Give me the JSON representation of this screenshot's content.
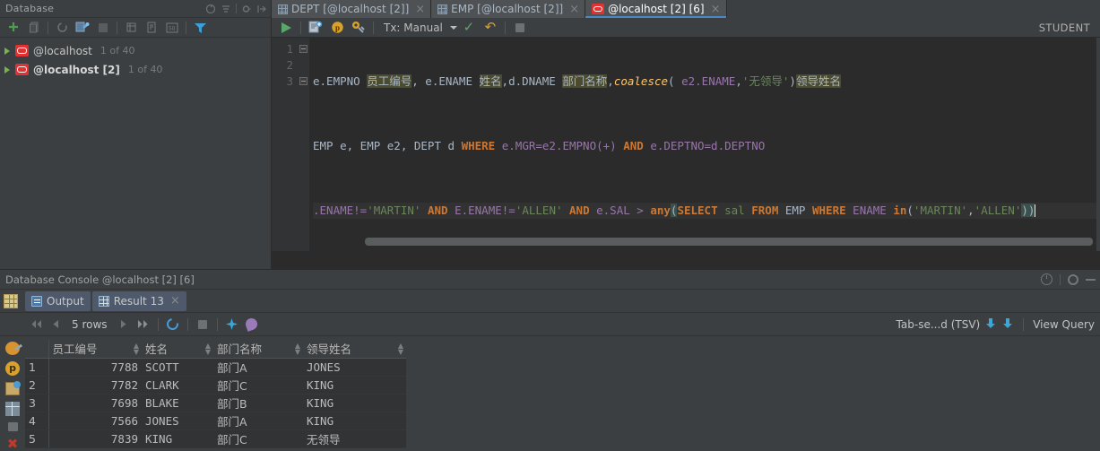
{
  "db_panel": {
    "title": "Database",
    "header_icons": [
      "sync-icon",
      "collapse-all-icon",
      "settings-icon",
      "hide-icon"
    ],
    "toolbar": [
      {
        "name": "add-icon",
        "label": "+"
      },
      {
        "name": "duplicate-icon",
        "label": ""
      },
      {
        "name": "refresh-icon",
        "label": ""
      },
      {
        "name": "datasource-properties-icon",
        "label": ""
      },
      {
        "name": "stop-icon",
        "label": ""
      },
      {
        "name": "jump-to-console-icon",
        "label": ""
      },
      {
        "name": "modify-table-icon",
        "label": ""
      },
      {
        "name": "sql-script-icon",
        "label": ""
      },
      {
        "name": "filter-icon",
        "label": ""
      }
    ],
    "tree": [
      {
        "label": "@localhost",
        "sub": "1 of 40",
        "bold": false,
        "icon": "oracle-datasource-icon"
      },
      {
        "label": "@localhost [2]",
        "sub": "1 of 40",
        "bold": true,
        "icon": "oracle-datasource-icon"
      }
    ]
  },
  "editor": {
    "tabs": [
      {
        "label": "DEPT [@localhost [2]]",
        "icon": "table-icon",
        "active": false,
        "close": "×"
      },
      {
        "label": "EMP [@localhost [2]]",
        "icon": "table-icon",
        "active": false,
        "close": "×"
      },
      {
        "label": "@localhost [2] [6]",
        "icon": "oracle-console-icon",
        "active": true,
        "close": "×"
      }
    ],
    "run_toolbar": {
      "execute": "execute-icon",
      "session_icon": "new-session-icon",
      "p_icon": "parameters-icon",
      "db_tools_icon": "db-tools-icon",
      "tx_label": "Tx: Manual",
      "commit_icon": "commit-icon",
      "rollback_icon": "rollback-icon",
      "stop_icon": "stop-icon",
      "schema_label": "STUDENT"
    },
    "gutter": [
      "1",
      "2",
      "3"
    ],
    "code_lines": [
      "e.EMPNO 员工编号, e.ENAME 姓名,d.DNAME 部门名称,coalesce( e2.ENAME,'无领导')领导姓名",
      "EMP e, EMP e2, DEPT d WHERE e.MGR=e2.EMPNO(+) AND e.DEPTNO=d.DEPTNO",
      ".ENAME!='MARTIN' AND E.ENAME!='ALLEN' AND e.SAL > any(SELECT sal FROM EMP WHERE ENAME in('MARTIN','ALLEN'))"
    ],
    "tokens": {
      "l1": {
        "t_e_empno": "e.EMPNO ",
        "a_empno": "员工编号",
        "c1": ", ",
        "t_e_ename": "e.ENAME ",
        "a_ename": "姓名",
        "c2": ",",
        "t_d_dname": "d.DNAME ",
        "a_dname": "部门名称",
        "c3": ",",
        "fn_coalesce": "coalesce",
        "p1": "( ",
        "t_e2_ename": "e2.ENAME",
        "c4": ",",
        "s_noboss": "'无领导'",
        "p2": ")",
        "a_boss": "领导姓名"
      },
      "l2": {
        "t1": "EMP e, EMP e2, DEPT d ",
        "kw_where": "WHERE",
        "t2": " e.MGR=e2.EMPNO(+) ",
        "kw_and1": "AND",
        "t3": " e.DEPTNO=d.DEPTNO"
      },
      "l3": {
        "t1": ".ENAME!=",
        "s1": "'MARTIN'",
        "sp1": " ",
        "kw_and1": "AND",
        "t2": " E.ENAME!=",
        "s2": "'ALLEN'",
        "sp2": " ",
        "kw_and2": "AND",
        "t3": " e.SAL > ",
        "kw_any": "any",
        "p1": "(",
        "kw_select": "SELECT",
        "t4": " sal ",
        "kw_from": "FROM",
        "t5": " EMP ",
        "kw_where": "WHERE",
        "t6": " ENAME ",
        "kw_in": "in",
        "p2": "(",
        "s3": "'MARTIN'",
        "c1": ",",
        "s4": "'ALLEN'",
        "p3": "))"
      }
    }
  },
  "console": {
    "title": "Database Console @localhost [2] [6]",
    "title_icons": [
      "help-icon",
      "settings-icon",
      "minimize-icon"
    ],
    "tabs": [
      {
        "label": "Output",
        "icon": "output-icon",
        "active": true,
        "closable": false
      },
      {
        "label": "Result 13",
        "icon": "result-grid-icon",
        "active": true,
        "closable": true,
        "close": "×"
      }
    ],
    "grid_toolbar": {
      "first_page_icon": "first-page-icon",
      "prev_page_icon": "prev-page-icon",
      "rows_label": "5 rows",
      "next_page_icon": "next-page-icon",
      "last_page_icon": "last-page-icon",
      "reload_icon": "reload-page-icon",
      "cancel_icon": "cancel-running-icon",
      "tx_icon": "transaction-icon",
      "pin_icon": "pin-tab-icon",
      "format_label": "Tab-se...d (TSV)",
      "export_icon": "export-data-icon",
      "import_icon": "import-data-icon",
      "view_query_label": "View Query"
    },
    "side_icons": [
      "wrench-icon",
      "parameters-icon",
      "value-editor-icon",
      "table-view-icon",
      "stop-icon",
      "close-icon"
    ]
  },
  "result": {
    "columns": [
      "员工编号",
      "姓名",
      "部门名称",
      "领导姓名"
    ],
    "rows": [
      {
        "n": "1",
        "cells": [
          "7788",
          "SCOTT",
          "部门A",
          "JONES"
        ]
      },
      {
        "n": "2",
        "cells": [
          "7782",
          "CLARK",
          "部门C",
          "KING"
        ]
      },
      {
        "n": "3",
        "cells": [
          "7698",
          "BLAKE",
          "部门B",
          "KING"
        ]
      },
      {
        "n": "4",
        "cells": [
          "7566",
          "JONES",
          "部门A",
          "KING"
        ]
      },
      {
        "n": "5",
        "cells": [
          "7839",
          "KING",
          "部门C",
          "无领导"
        ]
      }
    ]
  },
  "colors": {
    "accent": "#4a88c7",
    "keyword": "#cc7832",
    "string": "#6a8759",
    "function": "#ffc66d",
    "column": "#9876aa",
    "background": "#3c3f41",
    "editor_bg": "#2b2b2b"
  }
}
